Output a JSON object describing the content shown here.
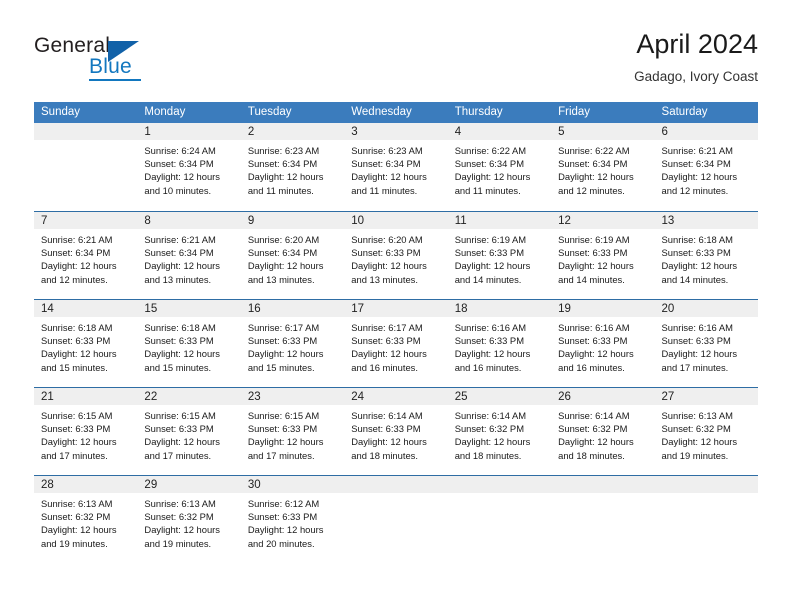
{
  "brand": {
    "name_part1": "General",
    "name_part2": "Blue",
    "logo_icon": "triangle-icon",
    "accent_color": "#1277bf"
  },
  "header": {
    "title": "April 2024",
    "location": "Gadago, Ivory Coast"
  },
  "theme": {
    "header_blue": "#3b7cbd",
    "row_divider_blue": "#2e6da4",
    "daynum_band_gray": "#efefef"
  },
  "weekdays": [
    "Sunday",
    "Monday",
    "Tuesday",
    "Wednesday",
    "Thursday",
    "Friday",
    "Saturday"
  ],
  "labels": {
    "sunrise_prefix": "Sunrise:",
    "sunset_prefix": "Sunset:",
    "daylight_prefix": "Daylight:"
  },
  "weeks": [
    [
      {
        "day": "",
        "blank": true,
        "sunrise": "",
        "sunset": "",
        "daylight_line1": "",
        "daylight_line2": ""
      },
      {
        "day": "1",
        "blank": false,
        "sunrise": "Sunrise: 6:24 AM",
        "sunset": "Sunset: 6:34 PM",
        "daylight_line1": "Daylight: 12 hours",
        "daylight_line2": "and 10 minutes."
      },
      {
        "day": "2",
        "blank": false,
        "sunrise": "Sunrise: 6:23 AM",
        "sunset": "Sunset: 6:34 PM",
        "daylight_line1": "Daylight: 12 hours",
        "daylight_line2": "and 11 minutes."
      },
      {
        "day": "3",
        "blank": false,
        "sunrise": "Sunrise: 6:23 AM",
        "sunset": "Sunset: 6:34 PM",
        "daylight_line1": "Daylight: 12 hours",
        "daylight_line2": "and 11 minutes."
      },
      {
        "day": "4",
        "blank": false,
        "sunrise": "Sunrise: 6:22 AM",
        "sunset": "Sunset: 6:34 PM",
        "daylight_line1": "Daylight: 12 hours",
        "daylight_line2": "and 11 minutes."
      },
      {
        "day": "5",
        "blank": false,
        "sunrise": "Sunrise: 6:22 AM",
        "sunset": "Sunset: 6:34 PM",
        "daylight_line1": "Daylight: 12 hours",
        "daylight_line2": "and 12 minutes."
      },
      {
        "day": "6",
        "blank": false,
        "sunrise": "Sunrise: 6:21 AM",
        "sunset": "Sunset: 6:34 PM",
        "daylight_line1": "Daylight: 12 hours",
        "daylight_line2": "and 12 minutes."
      }
    ],
    [
      {
        "day": "7",
        "blank": false,
        "sunrise": "Sunrise: 6:21 AM",
        "sunset": "Sunset: 6:34 PM",
        "daylight_line1": "Daylight: 12 hours",
        "daylight_line2": "and 12 minutes."
      },
      {
        "day": "8",
        "blank": false,
        "sunrise": "Sunrise: 6:21 AM",
        "sunset": "Sunset: 6:34 PM",
        "daylight_line1": "Daylight: 12 hours",
        "daylight_line2": "and 13 minutes."
      },
      {
        "day": "9",
        "blank": false,
        "sunrise": "Sunrise: 6:20 AM",
        "sunset": "Sunset: 6:34 PM",
        "daylight_line1": "Daylight: 12 hours",
        "daylight_line2": "and 13 minutes."
      },
      {
        "day": "10",
        "blank": false,
        "sunrise": "Sunrise: 6:20 AM",
        "sunset": "Sunset: 6:33 PM",
        "daylight_line1": "Daylight: 12 hours",
        "daylight_line2": "and 13 minutes."
      },
      {
        "day": "11",
        "blank": false,
        "sunrise": "Sunrise: 6:19 AM",
        "sunset": "Sunset: 6:33 PM",
        "daylight_line1": "Daylight: 12 hours",
        "daylight_line2": "and 14 minutes."
      },
      {
        "day": "12",
        "blank": false,
        "sunrise": "Sunrise: 6:19 AM",
        "sunset": "Sunset: 6:33 PM",
        "daylight_line1": "Daylight: 12 hours",
        "daylight_line2": "and 14 minutes."
      },
      {
        "day": "13",
        "blank": false,
        "sunrise": "Sunrise: 6:18 AM",
        "sunset": "Sunset: 6:33 PM",
        "daylight_line1": "Daylight: 12 hours",
        "daylight_line2": "and 14 minutes."
      }
    ],
    [
      {
        "day": "14",
        "blank": false,
        "sunrise": "Sunrise: 6:18 AM",
        "sunset": "Sunset: 6:33 PM",
        "daylight_line1": "Daylight: 12 hours",
        "daylight_line2": "and 15 minutes."
      },
      {
        "day": "15",
        "blank": false,
        "sunrise": "Sunrise: 6:18 AM",
        "sunset": "Sunset: 6:33 PM",
        "daylight_line1": "Daylight: 12 hours",
        "daylight_line2": "and 15 minutes."
      },
      {
        "day": "16",
        "blank": false,
        "sunrise": "Sunrise: 6:17 AM",
        "sunset": "Sunset: 6:33 PM",
        "daylight_line1": "Daylight: 12 hours",
        "daylight_line2": "and 15 minutes."
      },
      {
        "day": "17",
        "blank": false,
        "sunrise": "Sunrise: 6:17 AM",
        "sunset": "Sunset: 6:33 PM",
        "daylight_line1": "Daylight: 12 hours",
        "daylight_line2": "and 16 minutes."
      },
      {
        "day": "18",
        "blank": false,
        "sunrise": "Sunrise: 6:16 AM",
        "sunset": "Sunset: 6:33 PM",
        "daylight_line1": "Daylight: 12 hours",
        "daylight_line2": "and 16 minutes."
      },
      {
        "day": "19",
        "blank": false,
        "sunrise": "Sunrise: 6:16 AM",
        "sunset": "Sunset: 6:33 PM",
        "daylight_line1": "Daylight: 12 hours",
        "daylight_line2": "and 16 minutes."
      },
      {
        "day": "20",
        "blank": false,
        "sunrise": "Sunrise: 6:16 AM",
        "sunset": "Sunset: 6:33 PM",
        "daylight_line1": "Daylight: 12 hours",
        "daylight_line2": "and 17 minutes."
      }
    ],
    [
      {
        "day": "21",
        "blank": false,
        "sunrise": "Sunrise: 6:15 AM",
        "sunset": "Sunset: 6:33 PM",
        "daylight_line1": "Daylight: 12 hours",
        "daylight_line2": "and 17 minutes."
      },
      {
        "day": "22",
        "blank": false,
        "sunrise": "Sunrise: 6:15 AM",
        "sunset": "Sunset: 6:33 PM",
        "daylight_line1": "Daylight: 12 hours",
        "daylight_line2": "and 17 minutes."
      },
      {
        "day": "23",
        "blank": false,
        "sunrise": "Sunrise: 6:15 AM",
        "sunset": "Sunset: 6:33 PM",
        "daylight_line1": "Daylight: 12 hours",
        "daylight_line2": "and 17 minutes."
      },
      {
        "day": "24",
        "blank": false,
        "sunrise": "Sunrise: 6:14 AM",
        "sunset": "Sunset: 6:33 PM",
        "daylight_line1": "Daylight: 12 hours",
        "daylight_line2": "and 18 minutes."
      },
      {
        "day": "25",
        "blank": false,
        "sunrise": "Sunrise: 6:14 AM",
        "sunset": "Sunset: 6:32 PM",
        "daylight_line1": "Daylight: 12 hours",
        "daylight_line2": "and 18 minutes."
      },
      {
        "day": "26",
        "blank": false,
        "sunrise": "Sunrise: 6:14 AM",
        "sunset": "Sunset: 6:32 PM",
        "daylight_line1": "Daylight: 12 hours",
        "daylight_line2": "and 18 minutes."
      },
      {
        "day": "27",
        "blank": false,
        "sunrise": "Sunrise: 6:13 AM",
        "sunset": "Sunset: 6:32 PM",
        "daylight_line1": "Daylight: 12 hours",
        "daylight_line2": "and 19 minutes."
      }
    ],
    [
      {
        "day": "28",
        "blank": false,
        "sunrise": "Sunrise: 6:13 AM",
        "sunset": "Sunset: 6:32 PM",
        "daylight_line1": "Daylight: 12 hours",
        "daylight_line2": "and 19 minutes."
      },
      {
        "day": "29",
        "blank": false,
        "sunrise": "Sunrise: 6:13 AM",
        "sunset": "Sunset: 6:32 PM",
        "daylight_line1": "Daylight: 12 hours",
        "daylight_line2": "and 19 minutes."
      },
      {
        "day": "30",
        "blank": false,
        "sunrise": "Sunrise: 6:12 AM",
        "sunset": "Sunset: 6:33 PM",
        "daylight_line1": "Daylight: 12 hours",
        "daylight_line2": "and 20 minutes."
      },
      {
        "day": "",
        "blank": true,
        "sunrise": "",
        "sunset": "",
        "daylight_line1": "",
        "daylight_line2": ""
      },
      {
        "day": "",
        "blank": true,
        "sunrise": "",
        "sunset": "",
        "daylight_line1": "",
        "daylight_line2": ""
      },
      {
        "day": "",
        "blank": true,
        "sunrise": "",
        "sunset": "",
        "daylight_line1": "",
        "daylight_line2": ""
      },
      {
        "day": "",
        "blank": true,
        "sunrise": "",
        "sunset": "",
        "daylight_line1": "",
        "daylight_line2": ""
      }
    ]
  ]
}
